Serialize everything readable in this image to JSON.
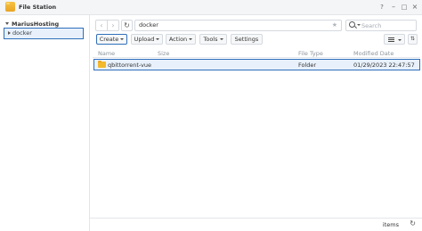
{
  "window": {
    "title": "File Station"
  },
  "sidebar": {
    "root_label": "MariusHosting",
    "items": [
      {
        "label": "docker"
      }
    ]
  },
  "nav": {
    "back_icon": "chevron-left-icon",
    "forward_icon": "chevron-right-icon",
    "refresh_icon": "refresh-icon",
    "path": "docker",
    "search_placeholder": "Search"
  },
  "toolbar": {
    "create_label": "Create",
    "upload_label": "Upload",
    "action_label": "Action",
    "tools_label": "Tools",
    "settings_label": "Settings"
  },
  "list": {
    "columns": [
      "Name",
      "Size",
      "File Type",
      "Modified Date"
    ],
    "rows": [
      {
        "name": "qbittorrent-vue",
        "size": "",
        "type": "Folder",
        "modified": "01/29/2023 22:47:57"
      }
    ]
  },
  "status": {
    "items_label": "items"
  },
  "colors": {
    "accent": "#2f6fba",
    "selection_bg": "#e8f1fb",
    "folder": "#f2b92c"
  }
}
